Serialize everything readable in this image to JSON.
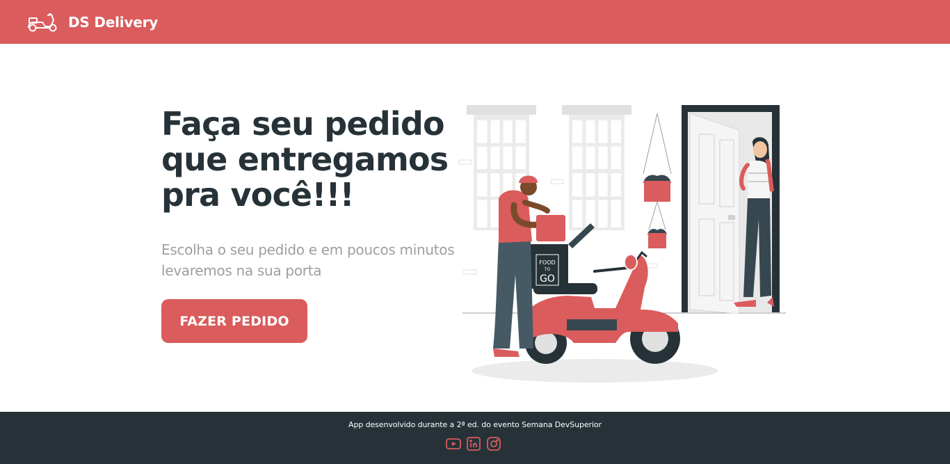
{
  "header": {
    "brand": "DS Delivery",
    "logo_icon": "scooter-icon"
  },
  "home": {
    "title": "Faça seu pedido que entregamos pra você!!!",
    "subtitle": "Escolha o seu pedido e em poucos minutos levaremos na sua porta",
    "cta_label": "FAZER PEDIDO",
    "illustration_box_text": [
      "FOOD",
      "TO",
      "GO"
    ]
  },
  "footer": {
    "text": "App desenvolvido durante a 2ª ed. do evento Semana DevSuperior",
    "social": [
      {
        "icon": "youtube-icon"
      },
      {
        "icon": "linkedin-icon"
      },
      {
        "icon": "instagram-icon"
      }
    ]
  },
  "colors": {
    "primary": "#DA5C5C",
    "dark": "#263238",
    "muted": "#9E9E9E",
    "background": "#FFFFFF"
  }
}
